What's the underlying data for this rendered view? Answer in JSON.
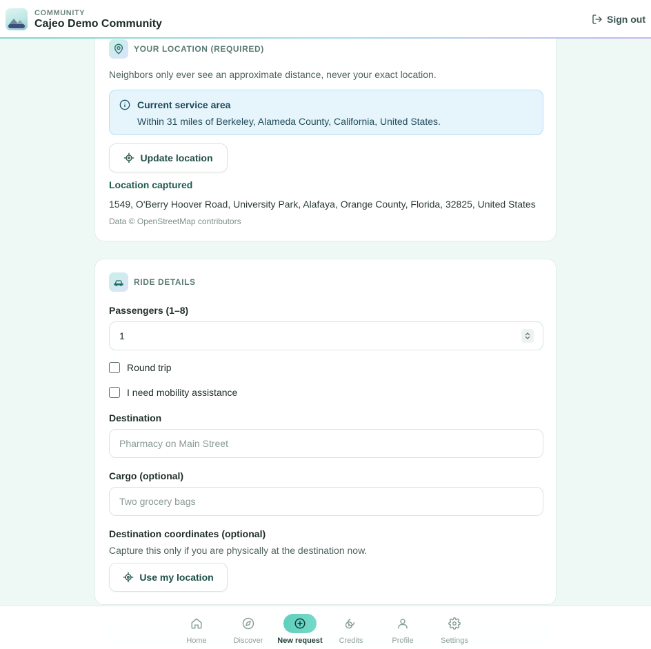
{
  "header": {
    "kicker": "COMMUNITY",
    "title": "Cajeo Demo Community",
    "signout_label": "Sign out"
  },
  "location": {
    "section_title": "YOUR LOCATION (REQUIRED)",
    "note": "Neighbors only ever see an approximate distance, never your exact location.",
    "service_area_title": "Current service area",
    "service_area_text": "Within 31 miles of Berkeley, Alameda County, California, United States.",
    "update_button": "Update location",
    "captured_label": "Location captured",
    "captured_address": "1549, O'Berry Hoover Road, University Park, Alafaya, Orange County, Florida, 32825, United States",
    "credit": "Data © OpenStreetMap contributors"
  },
  "ride": {
    "section_title": "RIDE DETAILS",
    "passengers_label": "Passengers (1–8)",
    "passengers_value": "1",
    "round_trip_label": "Round trip",
    "mobility_label": "I need mobility assistance",
    "destination_label": "Destination",
    "destination_placeholder": "Pharmacy on Main Street",
    "cargo_label": "Cargo (optional)",
    "cargo_placeholder": "Two grocery bags",
    "coords_label": "Destination coordinates (optional)",
    "coords_note": "Capture this only if you are physically at the destination now.",
    "use_location_button": "Use my location"
  },
  "nav": {
    "items": [
      {
        "label": "Home",
        "icon": "home-icon"
      },
      {
        "label": "Discover",
        "icon": "compass-icon"
      },
      {
        "label": "New request",
        "icon": "plus-circle-icon",
        "active": true
      },
      {
        "label": "Credits",
        "icon": "coins-icon"
      },
      {
        "label": "Profile",
        "icon": "user-icon"
      },
      {
        "label": "Settings",
        "icon": "gear-icon"
      }
    ]
  },
  "colors": {
    "accent": "#5ed0bd",
    "info_bg": "#e6f4fc",
    "page_bg": "#eef8f5"
  }
}
